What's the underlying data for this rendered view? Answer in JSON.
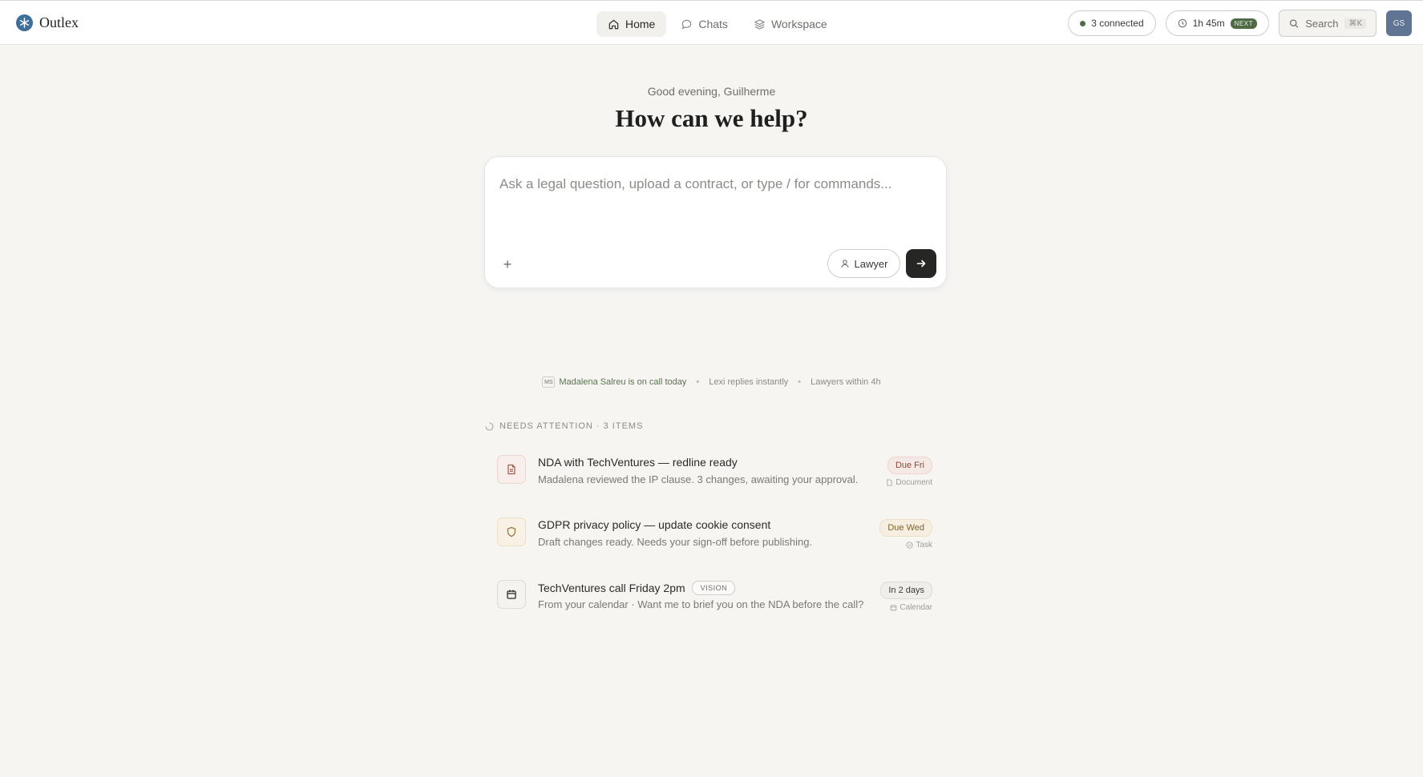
{
  "brand": {
    "name": "Outlex"
  },
  "nav": {
    "items": [
      {
        "label": "Home",
        "icon": "home-icon",
        "active": true
      },
      {
        "label": "Chats",
        "icon": "chat-icon",
        "active": false
      },
      {
        "label": "Workspace",
        "icon": "layers-icon",
        "active": false
      }
    ]
  },
  "toolbar": {
    "connected_label": "3 connected",
    "timer_label": "1h 45m",
    "timer_tag": "NEXT",
    "search_label": "Search",
    "search_shortcut": "⌘K",
    "avatar_initials": "GS"
  },
  "hero": {
    "greeting": "Good evening, Guilherme",
    "headline": "How can we help?"
  },
  "composer": {
    "placeholder": "Ask a legal question, upload a contract, or type / for commands...",
    "add_symbol": "+",
    "lawyer_label": "Lawyer"
  },
  "status": {
    "ms_initials": "MS",
    "on_call": "Madalena Salreu is on call today",
    "lexi": "Lexi replies instantly",
    "lawyers": "Lawyers within 4h",
    "separator": "•"
  },
  "attention": {
    "header": "NEEDS ATTENTION · 3 ITEMS",
    "items": [
      {
        "title": "NDA with TechVentures — redline ready",
        "subtitle": "Madalena reviewed the IP clause. 3 changes, awaiting your approval.",
        "due": "Due Fri",
        "kind": "Document",
        "icon": "document-icon",
        "color": "#a05a48"
      },
      {
        "title": "GDPR privacy policy — update cookie consent",
        "subtitle": "Draft changes ready. Needs your sign-off before publishing.",
        "due": "Due Wed",
        "kind": "Task",
        "icon": "shield-icon",
        "color": "#9a7a3a"
      },
      {
        "title": "TechVentures call Friday 2pm",
        "tag": "VISION",
        "subtitle": "From your calendar · Want me to brief you on the NDA before the call?",
        "due": "In 2 days",
        "kind": "Calendar",
        "icon": "calendar-icon",
        "color": "#2a2a28"
      }
    ]
  }
}
